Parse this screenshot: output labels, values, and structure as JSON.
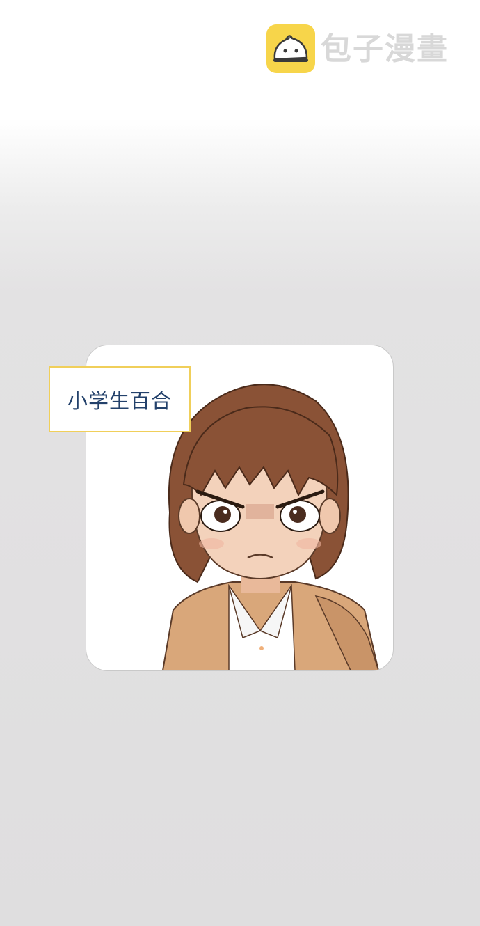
{
  "watermark": {
    "logo_icon": "bun-mascot-icon",
    "site_name": "包子漫畫"
  },
  "character_card": {
    "image": "angry-girl-portrait",
    "name": "小学生百合"
  },
  "colors": {
    "logo_yellow": "#f7d54a",
    "tag_border": "#f0cf5a",
    "tag_text": "#23416b",
    "hair": "#8a5236",
    "skin": "#f3d2bb",
    "jacket": "#d9a77a"
  }
}
